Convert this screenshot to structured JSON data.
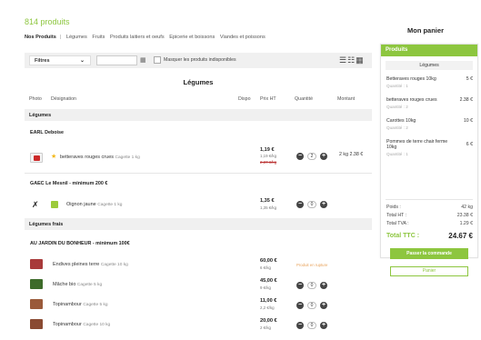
{
  "page": {
    "product_count": "814 produits"
  },
  "nav": {
    "items": [
      "Nos Produits",
      "Légumes",
      "Fruits",
      "Produits laitiers et oeufs",
      "Epicerie et boissons",
      "Viandes et poissons"
    ],
    "separator": "|"
  },
  "filters": {
    "select_label": "Filtres",
    "date_value": "",
    "mask_label": "Masquer les produits indisponibles",
    "mask_checked": false
  },
  "section_title": "Légumes",
  "columns": {
    "photo": "Photo",
    "designation": "Désignation",
    "dispo": "Dispo",
    "price": "Prix HT",
    "quantity": "Quantité",
    "amount": "Montant"
  },
  "categories": {
    "legumes": "Légumes",
    "legumes_frais": "Légumes frais"
  },
  "suppliers": {
    "s1": "EARL Deboise",
    "s2": "GAEC Le Mesnil - minimum 200 €",
    "s3": "AU JARDIN DU BONHEUR - minimum 100€"
  },
  "products": [
    {
      "name": "betteraves rouges crues",
      "pack": "Cagette 1 kg",
      "price": "1,19 €",
      "unit_price": "1,19 €/kg",
      "old_price": "2,37 €/kg",
      "qty": "2",
      "amount_qty": "2 kg",
      "amount": "2.38 €",
      "color": "#b22a4a"
    },
    {
      "name": "Oignon jaune",
      "pack": "Cagette 1 kg",
      "price": "1,35 €",
      "unit_price": "1,35 €/kg",
      "qty": "0",
      "color": "#9ccb3b"
    },
    {
      "name": "Endives pleines terre",
      "pack": "Cagette 10 kg",
      "price": "60,00 €",
      "unit_price": "6 €/kg",
      "status": "Produit en rupture",
      "color": "#a83a3a"
    },
    {
      "name": "Mâche bio",
      "pack": "Cagette 5 kg",
      "price": "45,00 €",
      "unit_price": "9 €/kg",
      "qty": "0",
      "color": "#3d6b2a"
    },
    {
      "name": "Topinambour",
      "pack": "Cagette 5 kg",
      "price": "11,00 €",
      "unit_price": "2,2 €/kg",
      "qty": "0",
      "color": "#9a5a3a"
    },
    {
      "name": "Topinambour",
      "pack": "Cagette 10 kg",
      "price": "20,00 €",
      "unit_price": "2 €/kg",
      "qty": "0",
      "color": "#8a4a32"
    }
  ],
  "cart": {
    "title": "Mon panier",
    "header": "Produits",
    "category": "Légumes",
    "items": [
      {
        "name": "Betteraves rouges 10kg",
        "qty": "Quantité : 1",
        "price": "5 €"
      },
      {
        "name": "betteraves rouges crues",
        "qty": "Quantité : 2",
        "price": "2.38 €"
      },
      {
        "name": "Carottes 10kg",
        "qty": "Quantité : 2",
        "price": "10 €"
      },
      {
        "name": "Pommes de terre chair ferme 10kg",
        "qty": "Quantité : 1",
        "price": "6 €"
      }
    ],
    "totals": {
      "weight_label": "Poids :",
      "weight": "42 kg",
      "ht_label": "Total HT :",
      "ht": "23.38 €",
      "tva_label": "Total TVA :",
      "tva": "1.29 €",
      "ttc_label": "Total TTC :",
      "ttc": "24.67 €"
    },
    "order_button": "Passer la commande",
    "cart_button": "Panier"
  },
  "colors": {
    "accent": "#8dc63f",
    "warning": "#e8a25a"
  },
  "icons": [
    "chevron-down-icon",
    "calendar-icon",
    "checkbox-icon",
    "list-view-icon",
    "grid-view-icon",
    "star-icon",
    "minus-icon",
    "plus-icon"
  ]
}
